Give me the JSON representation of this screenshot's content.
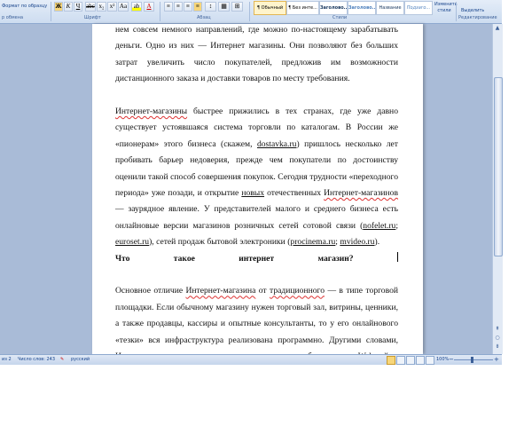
{
  "ribbon": {
    "clipboard": {
      "format_painter": "Формат по образцу",
      "group": "р обмена"
    },
    "font": {
      "group": "Шрифт",
      "superscript": "x²",
      "subscript": "x₂",
      "case": "Aa",
      "clear": "A"
    },
    "paragraph": {
      "group": "Абзац"
    },
    "styles": {
      "group": "Стили",
      "items": [
        "¶ Обычный",
        "¶ Без инте...",
        "Заголово...",
        "Заголово...",
        "Название",
        "Подзаго..."
      ],
      "change_styles": "Изменить стили"
    },
    "editing": {
      "group": "Редактирование",
      "select": "Выделить"
    }
  },
  "document": {
    "p1": "нем совсем немного направлений, где можно по-настоящему зарабатывать деньги. Одно из них — Интернет магазины. Они позволяют без больших затрат увеличить число покупателей, предложив им возможности дистанционного заказа и доставки товаров по месту требования.",
    "p2": {
      "a": "Интернет-магазины",
      "b": " быстрее прижились в тех странах, где уже давно существует устоявшаяся система торговли по каталогам. В России же «пионерам» этого бизнеса (скажем, ",
      "c": "dostavka.ru",
      "d": ") пришлось несколько лет пробивать барьер недоверия, прежде чем покупатели по достоинству оценили такой способ совершения покупок. Сегодня трудности «переходного периода» уже позади, и открытие ",
      "e": "новых",
      "f": " отечественных ",
      "g": "Интернет-магазинов",
      "h": " — заурядное явление. У представителей малого и среднего бизнеса есть онлайновые версии магазинов розничных сетей сотовой связи (",
      "i": "nofelet.ru",
      "j": "; ",
      "k": "euroset.ru",
      "l": "), сетей продаж бытовой электроники (",
      "m": "procinema.ru",
      "n": "; ",
      "o": "mvideo.ru",
      "p": ")."
    },
    "heading": "Что такое интернет магазин?",
    "p3": {
      "a": "Основное отличие ",
      "b": "Интернет-магазина",
      "c": " от ",
      "d": "традиционного",
      "e": " — в типе торговой площадки. Если обычному магазину нужен торговый зал, витрины, ценники, а также продавцы, кассиры и опытные консультанты, то у его онлайнового «тезки» вся инфраструктура реализована программно. Другими словами, Интернет-магазин — это совокупность программ, работающих на Web-сайте, которые позволяют покупателю дистанционно выбрать товар из каталога и оформить его заказ. Функции витрины и торгового зала выполняют «страницы» с иллюстрированным каталогом товаров, а консультантов — подсказки, инструкции и описания. Все остальное — как в обычном"
    }
  },
  "statusbar": {
    "page": "из 2",
    "word_count": "Число слов: 243",
    "language": "русский",
    "zoom": "100%"
  },
  "colors": {
    "ribbon": "#dbe6f4",
    "workspace": "#a9bbd7",
    "spell_underline": "#dd3333"
  }
}
